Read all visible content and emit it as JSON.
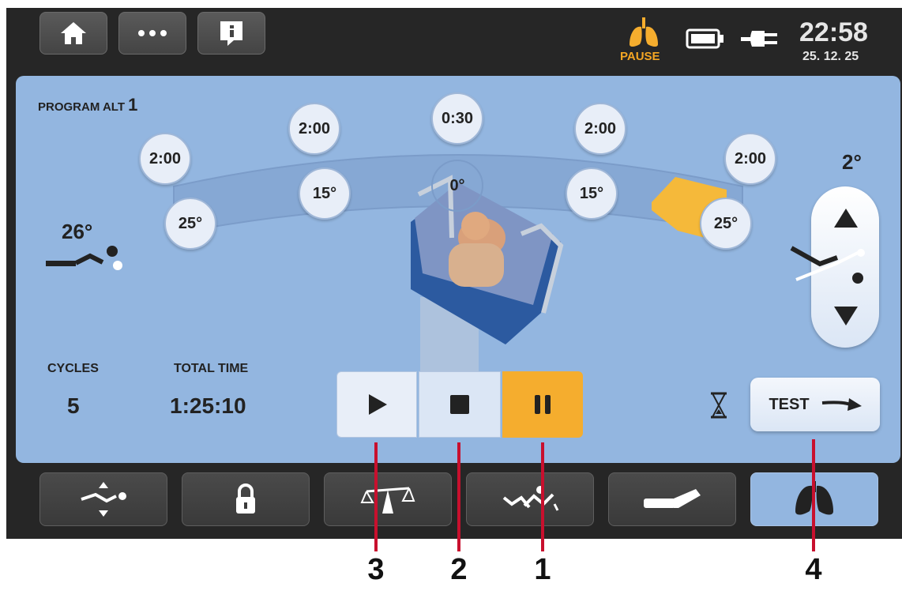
{
  "status": {
    "pause_label": "PAUSE",
    "time": "22:58",
    "date": "25. 12. 25"
  },
  "program": {
    "label": "PROGRAM ALT",
    "number": "1"
  },
  "arc": {
    "times": [
      "2:00",
      "2:00",
      "0:30",
      "2:00",
      "2:00"
    ],
    "angles": [
      "25°",
      "15°",
      "0°",
      "15°",
      "25°"
    ]
  },
  "current_angle": "26°",
  "right_angle": "2°",
  "cycles": {
    "label": "CYCLES",
    "value": "5"
  },
  "total_time": {
    "label": "TOTAL TIME",
    "value": "1:25:10"
  },
  "test_button": {
    "label": "TEST"
  },
  "callouts": [
    "3",
    "2",
    "1",
    "4"
  ],
  "colors": {
    "accent": "#f5ad2e",
    "panel": "#93b6e0",
    "screen": "#262626",
    "callout": "#c8102e"
  },
  "icons": {
    "home": "home-icon",
    "more": "more-icon",
    "info": "info-icon",
    "lungs": "lungs-icon",
    "battery": "battery-icon",
    "plug": "plug-icon"
  }
}
